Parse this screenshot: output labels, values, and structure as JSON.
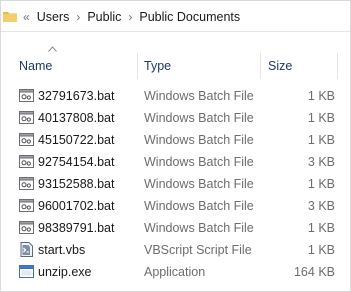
{
  "breadcrumb": {
    "overflow": "«",
    "items": [
      "Users",
      "Public",
      "Public Documents"
    ],
    "separator": "›"
  },
  "columns": {
    "name": "Name",
    "type": "Type",
    "size": "Size",
    "sorted_by": "name"
  },
  "files": [
    {
      "name": "32791673.bat",
      "type": "Windows Batch File",
      "size": "1 KB",
      "icon": "batch-file-icon"
    },
    {
      "name": "40137808.bat",
      "type": "Windows Batch File",
      "size": "1 KB",
      "icon": "batch-file-icon"
    },
    {
      "name": "45150722.bat",
      "type": "Windows Batch File",
      "size": "1 KB",
      "icon": "batch-file-icon"
    },
    {
      "name": "92754154.bat",
      "type": "Windows Batch File",
      "size": "3 KB",
      "icon": "batch-file-icon"
    },
    {
      "name": "93152588.bat",
      "type": "Windows Batch File",
      "size": "1 KB",
      "icon": "batch-file-icon"
    },
    {
      "name": "96001702.bat",
      "type": "Windows Batch File",
      "size": "3 KB",
      "icon": "batch-file-icon"
    },
    {
      "name": "98389791.bat",
      "type": "Windows Batch File",
      "size": "1 KB",
      "icon": "batch-file-icon"
    },
    {
      "name": "start.vbs",
      "type": "VBScript Script File",
      "size": "1 KB",
      "icon": "vbscript-file-icon"
    },
    {
      "name": "unzip.exe",
      "type": "Application",
      "size": "164 KB",
      "icon": "application-icon"
    }
  ],
  "colors": {
    "header_text": "#1f3864",
    "secondary_text": "#6d6d6d",
    "folder": "#e8b94a"
  }
}
